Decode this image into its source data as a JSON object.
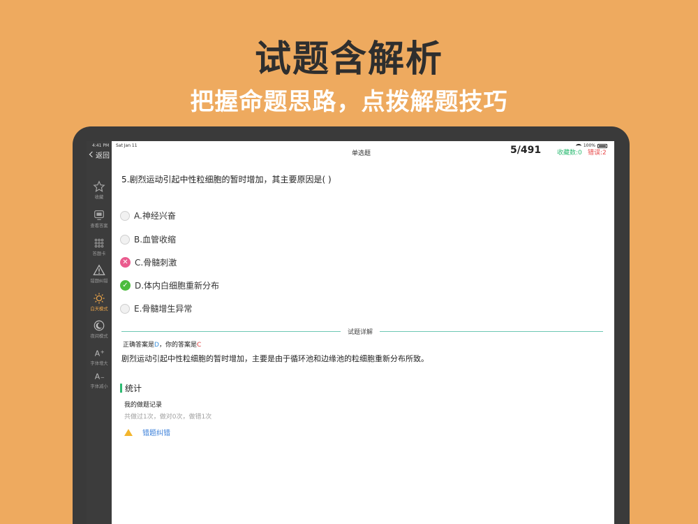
{
  "promo": {
    "headline": "试题含解析",
    "subheadline": "把握命题思路，点拨解题技巧"
  },
  "status_bar": {
    "time": "4:41 PM",
    "date": "Sat Jan 11",
    "battery": "100%"
  },
  "nav": {
    "back_label": "返回",
    "title": "单选题",
    "progress": "5/491",
    "favorites": "收藏数:0",
    "errors": "错误:2"
  },
  "sidebar": {
    "items": [
      {
        "label": "收藏",
        "icon": "star-icon"
      },
      {
        "label": "查看答案",
        "icon": "monitor-icon"
      },
      {
        "label": "答题卡",
        "icon": "grid-icon"
      },
      {
        "label": "错题纠错",
        "icon": "warning-icon"
      },
      {
        "label": "白天模式",
        "icon": "sun-icon"
      },
      {
        "label": "夜间模式",
        "icon": "moon-icon"
      },
      {
        "label": "字体增大",
        "icon": "font-increase-icon"
      },
      {
        "label": "字体减小",
        "icon": "font-decrease-icon"
      }
    ]
  },
  "question": {
    "text": "5.剧烈运动引起中性粒细胞的暂时增加，其主要原因是( )",
    "options": [
      {
        "label": "A.神经兴奋",
        "state": "none"
      },
      {
        "label": "B.血管收缩",
        "state": "none"
      },
      {
        "label": "C.骨髓刺激",
        "state": "wrong"
      },
      {
        "label": "D.体内白细胞重新分布",
        "state": "correct"
      },
      {
        "label": "E.骨髓增生异常",
        "state": "none"
      }
    ]
  },
  "explanation": {
    "section_label": "试题详解",
    "correct_prefix": "正确答案是",
    "correct_answer": "D",
    "mine_prefix": "，你的答案是",
    "my_answer": "C",
    "text": "剧烈运动引起中性粒细胞的暂时增加，主要是由于循环池和边缘池的粒细胞重新分布所致。"
  },
  "stats": {
    "title": "统计",
    "record_title": "我的做题记录",
    "record_detail": "共做过1次，做对0次，做错1次",
    "report_label": "错题纠错"
  },
  "colors": {
    "background": "#eeaa5f",
    "accent_green": "#2ebb73",
    "error_red": "#e84a4a",
    "link_blue": "#3a7fd9"
  }
}
